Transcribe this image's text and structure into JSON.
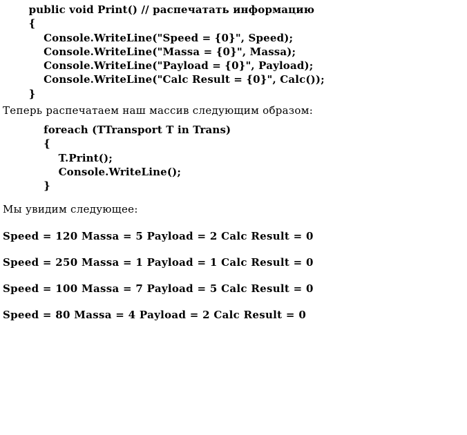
{
  "code_block_1": "       public void Print() // распечатать информацию\n       {\n           Console.WriteLine(\"Speed = {0}\", Speed);\n           Console.WriteLine(\"Massa = {0}\", Massa);\n           Console.WriteLine(\"Payload = {0}\", Payload);\n           Console.WriteLine(\"Calc Result = {0}\", Calc());\n       }",
  "para_1": "Теперь распечатаем наш массив следующим образом:",
  "code_block_2": "           foreach (TTransport T in Trans)\n           {\n               T.Print();\n               Console.WriteLine();\n           }",
  "para_2": "Мы увидим следующее:",
  "output": [
    "Speed = 120 Massa = 5 Payload = 2 Calc Result = 0",
    "Speed = 250 Massa = 1 Payload = 1 Calc Result = 0",
    "Speed = 100 Massa = 7 Payload = 5 Calc Result = 0",
    "Speed = 80 Massa = 4 Payload = 2 Calc Result = 0"
  ]
}
